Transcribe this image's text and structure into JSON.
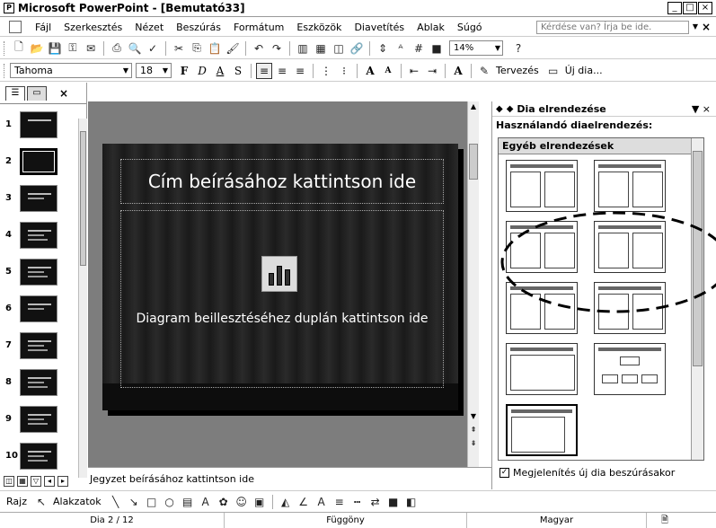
{
  "window": {
    "title": "Microsoft PowerPoint - [Bemutató33]",
    "controls": [
      "_",
      "□",
      "×"
    ]
  },
  "menubar": {
    "items": [
      "Fájl",
      "Szerkesztés",
      "Nézet",
      "Beszúrás",
      "Formátum",
      "Eszközök",
      "Diavetítés",
      "Ablak",
      "Súgó"
    ],
    "ask_placeholder": "Kérdése van? Írja be ide.",
    "close_label": "×"
  },
  "standard_toolbar": {
    "zoom": "14%"
  },
  "formatting_toolbar": {
    "font": "Tahoma",
    "size": "18",
    "bold": "F",
    "italic": "D",
    "underline": "A",
    "shadow": "S",
    "design_label": "Tervezés",
    "new_slide_label": "Új dia..."
  },
  "slides_panel": {
    "tabs": [
      "☰",
      "▭"
    ],
    "close": "×",
    "selected": 2,
    "thumbnails": [
      "1",
      "2",
      "3",
      "4",
      "5",
      "6",
      "7",
      "8",
      "9",
      "10"
    ]
  },
  "slide": {
    "title_placeholder": "Cím beírásához kattintson ide",
    "body_placeholder": "Diagram beillesztéséhez duplán kattintson ide"
  },
  "notes": {
    "placeholder": "Jegyzet beírásához kattintson ide"
  },
  "task_pane": {
    "title": "Dia elrendezése",
    "subtitle": "Használandó diaelrendezés:",
    "section": "Egyéb elrendezések",
    "checkbox_label": "Megjelenítés új dia beszúrásakor",
    "checkbox_checked": true
  },
  "draw_toolbar": {
    "draw_label": "Rajz",
    "shapes_label": "Alakzatok"
  },
  "statusbar": {
    "slide_pos": "Dia 2 / 12",
    "design": "Függöny",
    "language": "Magyar"
  }
}
